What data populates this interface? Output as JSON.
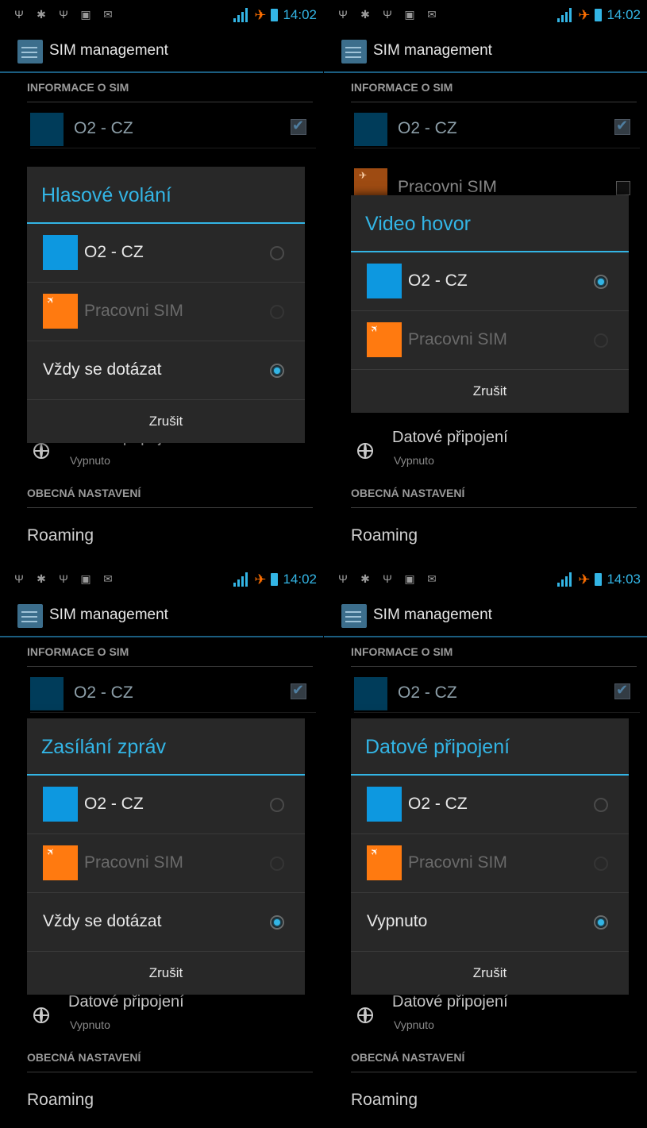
{
  "statusbars": [
    {
      "time": "14:02"
    },
    {
      "time": "14:02"
    },
    {
      "time": "14:02"
    },
    {
      "time": "14:03"
    }
  ],
  "app": {
    "title": "SIM management"
  },
  "sections": {
    "sim_info": "INFORMACE O SIM",
    "general": "OBECNÁ NASTAVENÍ"
  },
  "sims": {
    "sim1": {
      "name": "O2 - CZ",
      "checked": true
    },
    "sim2": {
      "name": "Pracovni SIM",
      "checked": false
    }
  },
  "data_connection": {
    "title": "Datové připojení",
    "value": "Vypnuto"
  },
  "roaming": "Roaming",
  "dialogs": [
    {
      "title": "Hlasové volání",
      "options": [
        "O2 - CZ",
        "Pracovni SIM",
        "Vždy se dotázat"
      ],
      "selected": "Vždy se dotázat",
      "cancel": "Zrušit"
    },
    {
      "title": "Video hovor",
      "options": [
        "O2 - CZ",
        "Pracovni SIM"
      ],
      "selected": "O2 - CZ",
      "cancel": "Zrušit"
    },
    {
      "title": "Zasílání zpráv",
      "options": [
        "O2 - CZ",
        "Pracovni SIM",
        "Vždy se dotázat"
      ],
      "selected": "Vždy se dotázat",
      "cancel": "Zrušit"
    },
    {
      "title": "Datové připojení",
      "options": [
        "O2 - CZ",
        "Pracovni SIM",
        "Vypnuto"
      ],
      "selected": "Vypnuto",
      "cancel": "Zrušit"
    }
  ],
  "colors": {
    "accent": "#33b5e5",
    "sim1": "#0d98e0",
    "sim2": "#ff7a10",
    "background": "#000000",
    "dialog": "#282828"
  },
  "icons": [
    "usb-icon",
    "debug-icon",
    "usb-icon",
    "screenshot-icon",
    "email-icon",
    "signal-icon",
    "airplane-icon",
    "battery-icon",
    "app-icon",
    "globe-icon",
    "checkbox-icon",
    "radio-icon"
  ]
}
